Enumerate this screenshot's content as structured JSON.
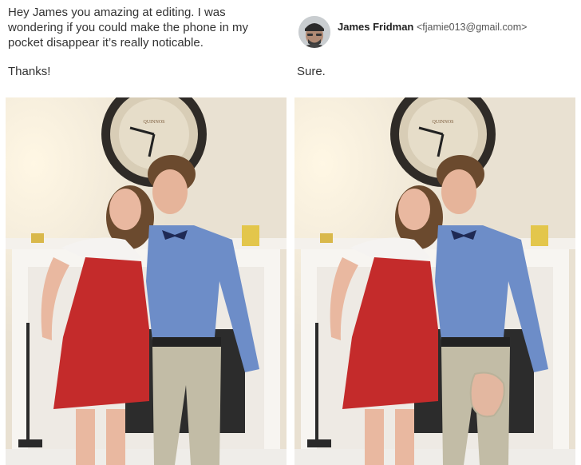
{
  "request": {
    "text": "Hey James you amazing at editing. I was wondering if you could make the phone in my pocket disappear it’s really noticable.",
    "sign_off": "Thanks!"
  },
  "reply": {
    "author_name": "James Fridman",
    "author_email": "<fjamie013@gmail.com>",
    "text": "Sure."
  },
  "photos": {
    "original": {
      "clock_brand": "QUINNOS"
    },
    "edited": {
      "clock_brand": "QUINNOS"
    }
  }
}
